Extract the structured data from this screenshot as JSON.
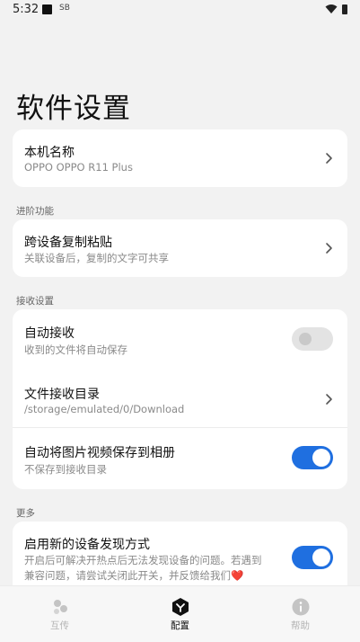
{
  "status_bar": {
    "time": "5:32",
    "sim_label": "SB"
  },
  "page": {
    "title": "软件设置"
  },
  "device_card": {
    "title": "本机名称",
    "subtitle": "OPPO OPPO R11 Plus"
  },
  "sections": {
    "advanced": "进阶功能",
    "receive": "接收设置",
    "more": "更多"
  },
  "clipboard": {
    "title": "跨设备复制粘贴",
    "subtitle": "关联设备后，复制的文字可共享"
  },
  "auto_receive": {
    "title": "自动接收",
    "subtitle": "收到的文件将自动保存",
    "enabled": false
  },
  "receive_dir": {
    "title": "文件接收目录",
    "subtitle": "/storage/emulated/0/Download"
  },
  "save_album": {
    "title": "自动将图片视频保存到相册",
    "subtitle": "不保存到接收目录",
    "enabled": true
  },
  "new_discovery": {
    "title": "启用新的设备发现方式",
    "subtitle_line1": "开启后可解决开热点后无法发现设备的问题。若遇到",
    "subtitle_line2": "兼容问题，请尝试关闭此开关，并反馈给我们❤️",
    "enabled": true
  },
  "bottom_nav": {
    "items": [
      {
        "label": "互传",
        "icon": "dots-icon",
        "active": false
      },
      {
        "label": "配置",
        "icon": "cube-icon",
        "active": true
      },
      {
        "label": "帮助",
        "icon": "info-icon",
        "active": false
      }
    ]
  },
  "colors": {
    "accent": "#1f6fe0",
    "background": "#f2f2f2",
    "card": "#ffffff"
  }
}
